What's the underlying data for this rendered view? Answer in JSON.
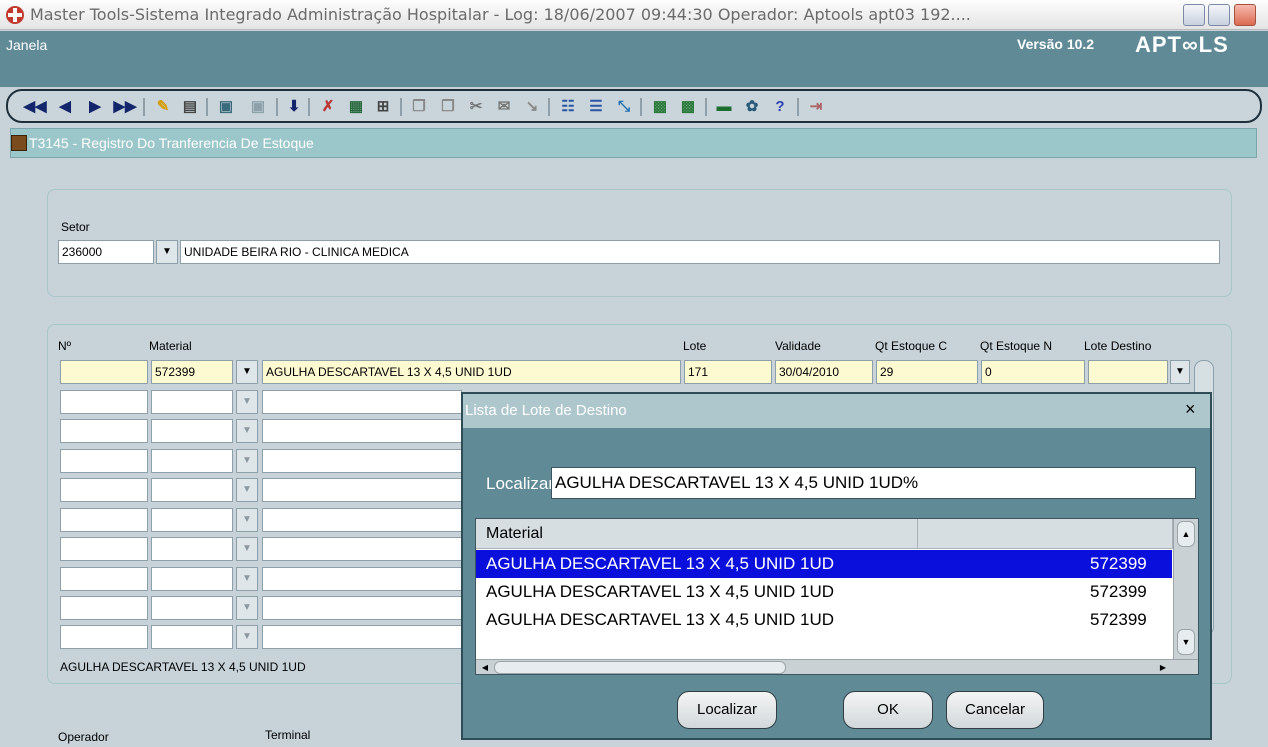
{
  "window": {
    "title": "Master Tools-Sistema Integrado Administração Hospitalar - Log: 18/06/2007 09:44:30 Operador: Aptools apt03 192...."
  },
  "menu": {
    "janela": "Janela",
    "version": "Versão 10.2",
    "logo": "APT∞LS"
  },
  "toolbar": {
    "icons": [
      "first-record-icon",
      "previous-record-icon",
      "next-record-icon",
      "last-record-icon",
      "pencil-icon",
      "printer-icon",
      "help-form-icon",
      "help-list-icon",
      "down-arrow-icon",
      "delete-record-icon",
      "insert-record-icon",
      "duplicate-record-icon",
      "copy-icon",
      "paste-icon",
      "cut-icon",
      "notes-icon",
      "clear-icon",
      "query-icon",
      "execute-query-icon",
      "cancel-query-icon",
      "lov-icon",
      "lov2-icon",
      "screen-icon",
      "wizard-icon",
      "help-icon",
      "exit-icon"
    ],
    "accent": "#13256b"
  },
  "form": {
    "title": "T3145 - Registro Do Tranferencia De Estoque",
    "setor_label": "Setor",
    "setor_code": "236000",
    "setor_name": "UNIDADE BEIRA RIO - CLINICA MEDICA"
  },
  "grid": {
    "headers": {
      "num": "Nº",
      "material": "Material",
      "lote": "Lote",
      "validade": "Validade",
      "qt_c": "Qt Estoque C",
      "qt_n": "Qt Estoque N",
      "lote_destino": "Lote Destino"
    },
    "first_row": {
      "num": "",
      "code": "572399",
      "desc": "AGULHA DESCARTAVEL 13 X 4,5 UNID 1UD",
      "lote": "171",
      "validade": "30/04/2010",
      "qt_c": "29",
      "qt_n": "0",
      "lote_destino": ""
    },
    "empty_rows": 9,
    "status_text": "AGULHA DESCARTAVEL 13 X 4,5 UNID 1UD"
  },
  "footer": {
    "operador_label": "Operador",
    "terminal_label": "Terminal"
  },
  "dialog": {
    "title": "Lista de Lote de Destino",
    "close": "×",
    "find_label": "Localizar",
    "find_value": "AGULHA DESCARTAVEL 13 X 4,5 UNID 1UD%",
    "column_material": "Material",
    "rows": [
      {
        "material": "AGULHA DESCARTAVEL 13 X 4,5 UNID 1UD",
        "code": "572399",
        "selected": true
      },
      {
        "material": "AGULHA DESCARTAVEL 13 X 4,5 UNID 1UD",
        "code": "572399",
        "selected": false
      },
      {
        "material": "AGULHA DESCARTAVEL 13 X 4,5 UNID 1UD",
        "code": "572399",
        "selected": false
      }
    ],
    "buttons": {
      "find": "Localizar",
      "ok": "OK",
      "cancel": "Cancelar"
    },
    "selection_color": "#0b0fdc"
  }
}
